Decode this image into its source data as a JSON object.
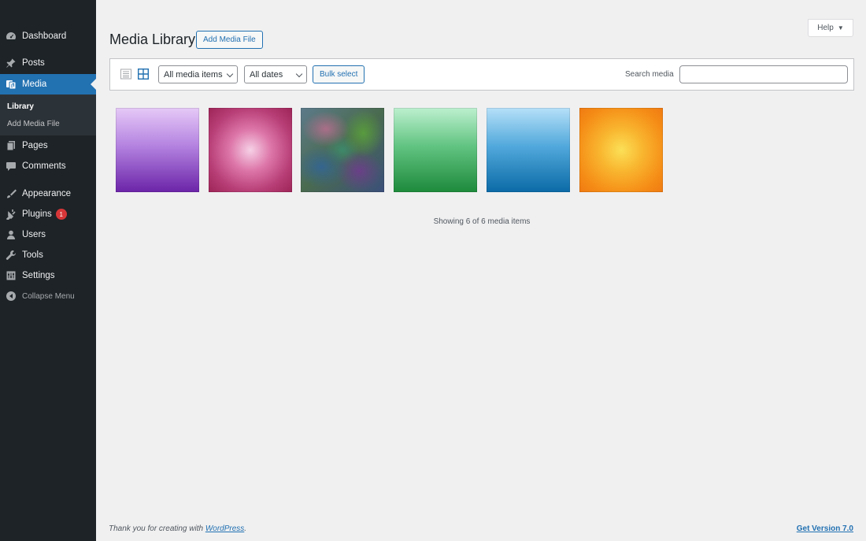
{
  "sidebar": {
    "items": [
      {
        "label": "Dashboard",
        "icon": "dashboard-icon"
      },
      {
        "label": "Posts",
        "icon": "pin-icon"
      },
      {
        "label": "Media",
        "icon": "media-icon"
      },
      {
        "label": "Pages",
        "icon": "pages-icon"
      },
      {
        "label": "Comments",
        "icon": "comments-icon"
      },
      {
        "label": "Appearance",
        "icon": "brush-icon"
      },
      {
        "label": "Plugins",
        "icon": "plugin-icon",
        "badge": "1"
      },
      {
        "label": "Users",
        "icon": "user-icon"
      },
      {
        "label": "Tools",
        "icon": "wrench-icon"
      },
      {
        "label": "Settings",
        "icon": "settings-icon"
      }
    ],
    "submenu": [
      "Library",
      "Add Media File"
    ],
    "collapse_label": "Collapse Menu"
  },
  "header": {
    "title": "Media Library",
    "add_button": "Add Media File",
    "help_label": "Help"
  },
  "toolbar": {
    "filter_type": "All media items",
    "filter_date": "All dates",
    "bulk_select": "Bulk select",
    "search_label": "Search media",
    "search_value": ""
  },
  "media": {
    "items": [
      {
        "colors": [
          "#e6c9f7",
          "#6b24a8"
        ]
      },
      {
        "colors": [
          "#f6d1e6",
          "#9d2456"
        ]
      },
      {
        "colors": [
          "#5c7a8a",
          "#3b4f7a"
        ]
      },
      {
        "colors": [
          "#bdf0cf",
          "#1d8a3b"
        ]
      },
      {
        "colors": [
          "#b6e0f8",
          "#0b6aa6"
        ]
      },
      {
        "colors": [
          "#fbe057",
          "#f07a12"
        ]
      }
    ],
    "showing_text": "Showing 6 of 6 media items"
  },
  "footer": {
    "thanks_prefix": "Thank you for creating with ",
    "wordpress_link": "WordPress",
    "thanks_suffix": ".",
    "version_link": "Get Version 7.0"
  },
  "colors": {
    "sidebar_bg": "#1d2327",
    "accent": "#2271b1",
    "badge": "#d63638",
    "page_bg": "#f0f0f1"
  }
}
